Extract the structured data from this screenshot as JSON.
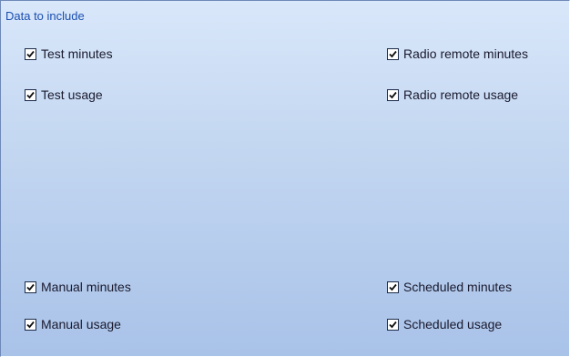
{
  "group": {
    "title": "Data to include"
  },
  "checkboxes": {
    "test_minutes": {
      "label": "Test minutes",
      "checked": true
    },
    "test_usage": {
      "label": "Test usage",
      "checked": true
    },
    "radio_remote_minutes": {
      "label": "Radio remote minutes",
      "checked": true
    },
    "radio_remote_usage": {
      "label": "Radio remote usage",
      "checked": true
    },
    "manual_minutes": {
      "label": "Manual minutes",
      "checked": true
    },
    "manual_usage": {
      "label": "Manual usage",
      "checked": true
    },
    "scheduled_minutes": {
      "label": "Scheduled minutes",
      "checked": true
    },
    "scheduled_usage": {
      "label": "Scheduled usage",
      "checked": true
    }
  },
  "colors": {
    "group_title": "#1a4fb0",
    "panel_top": "#d9e7fa",
    "panel_bottom": "#a9c2e8",
    "checkbox_border": "#1c2b48"
  },
  "icons": {
    "check": "checkmark-icon"
  }
}
